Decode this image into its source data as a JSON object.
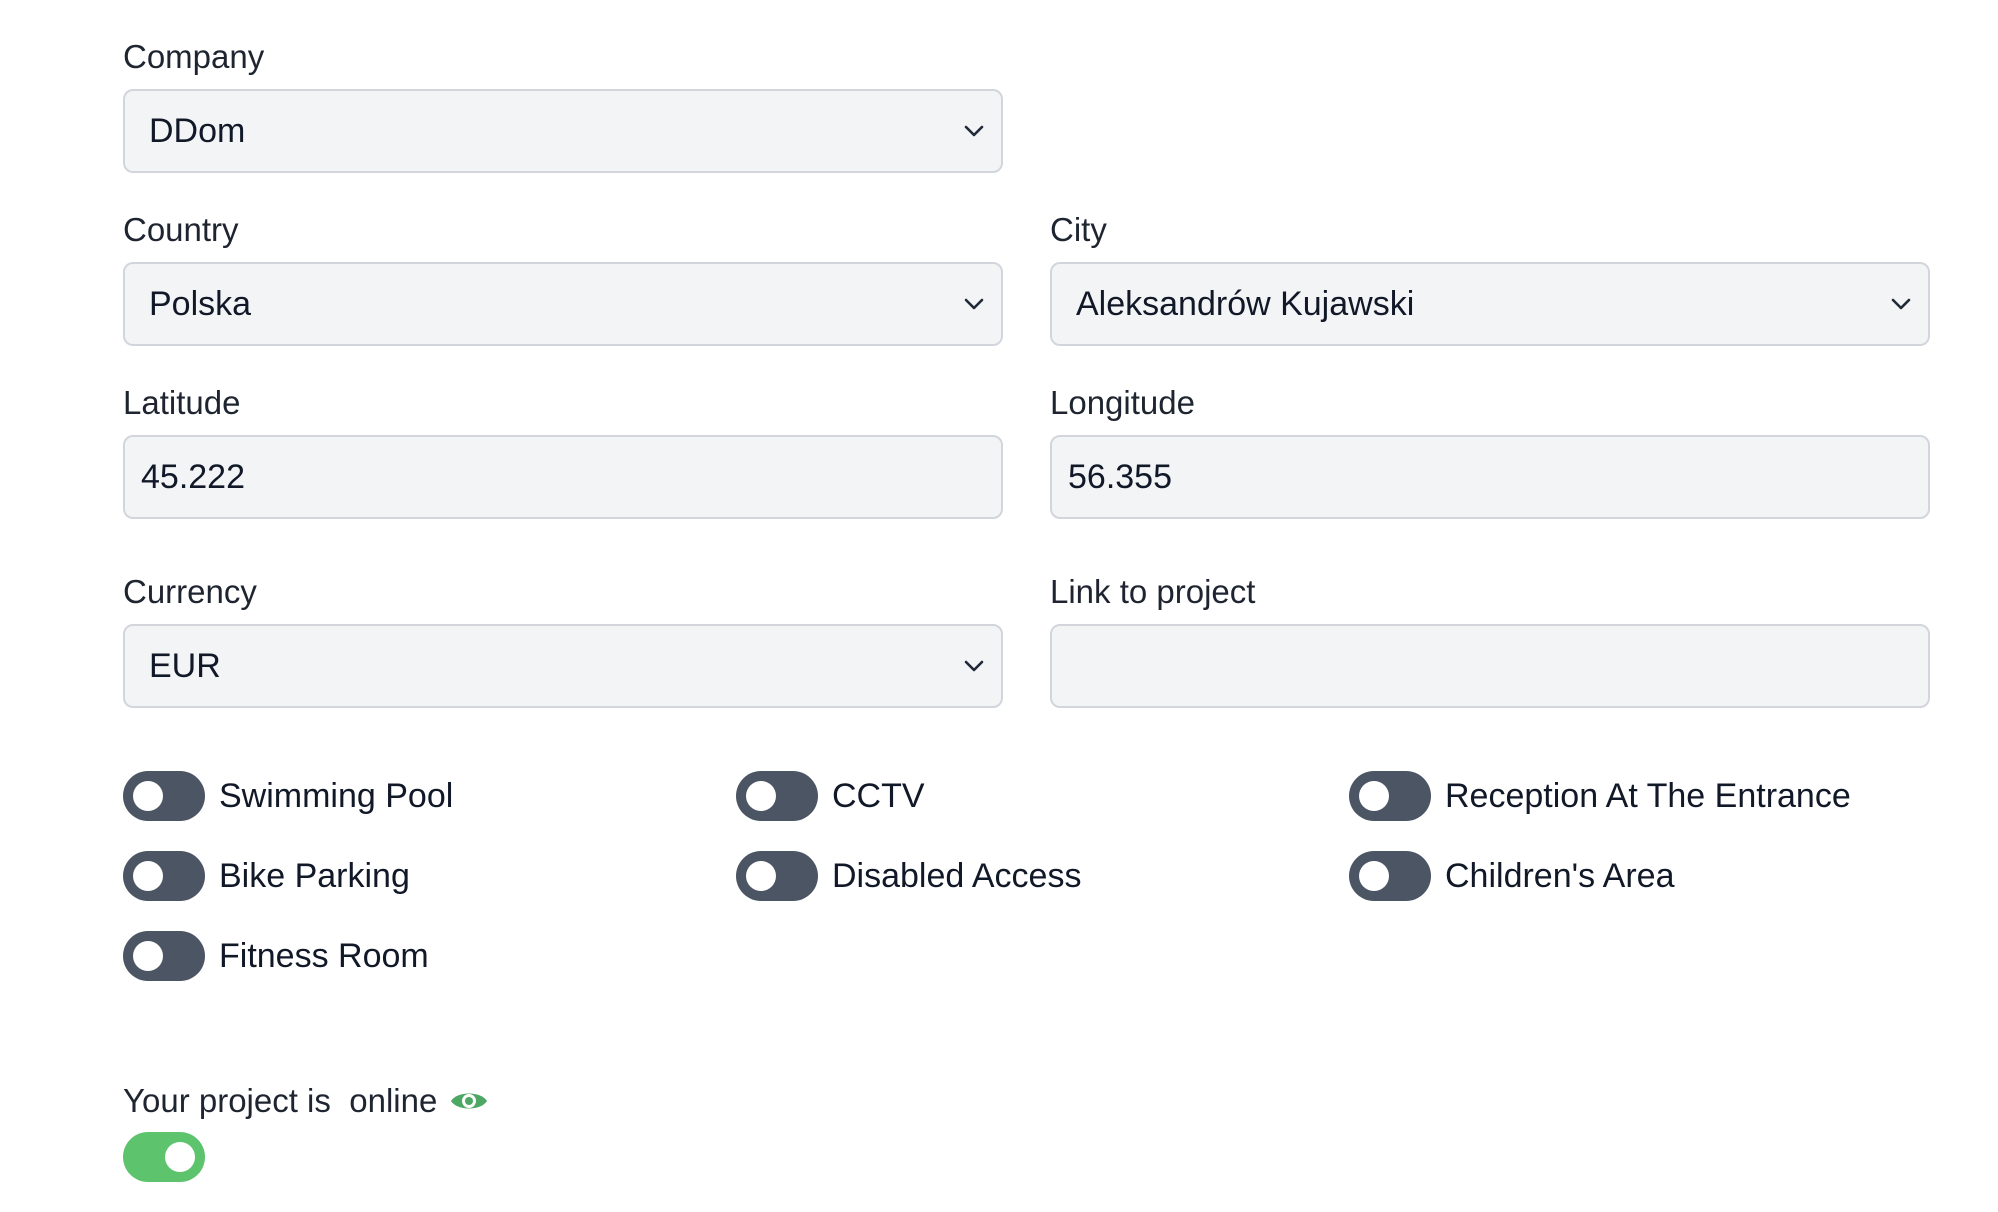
{
  "form": {
    "company": {
      "label": "Company",
      "value": "DDom"
    },
    "country": {
      "label": "Country",
      "value": "Polska"
    },
    "city": {
      "label": "City",
      "value": "Aleksandrów Kujawski"
    },
    "latitude": {
      "label": "Latitude",
      "value": "45.222"
    },
    "longitude": {
      "label": "Longitude",
      "value": "56.355"
    },
    "currency": {
      "label": "Currency",
      "value": "EUR"
    },
    "link": {
      "label": "Link to project",
      "value": ""
    }
  },
  "amenities": [
    {
      "label": "Swimming Pool",
      "on": false
    },
    {
      "label": "CCTV",
      "on": false
    },
    {
      "label": "Reception At The Entrance",
      "on": false
    },
    {
      "label": "Bike Parking",
      "on": false
    },
    {
      "label": "Disabled Access",
      "on": false
    },
    {
      "label": "Children's Area",
      "on": false
    },
    {
      "label": "Fitness Room",
      "on": false
    }
  ],
  "status": {
    "prefix": "Your project is",
    "state": "online",
    "icon": "eye-icon",
    "on": true
  },
  "colors": {
    "toggle_off": "#4b5563",
    "toggle_on": "#5dc46d",
    "eye_icon": "#4ea865",
    "field_bg": "#f3f4f6",
    "field_border": "#d2d6dc"
  }
}
